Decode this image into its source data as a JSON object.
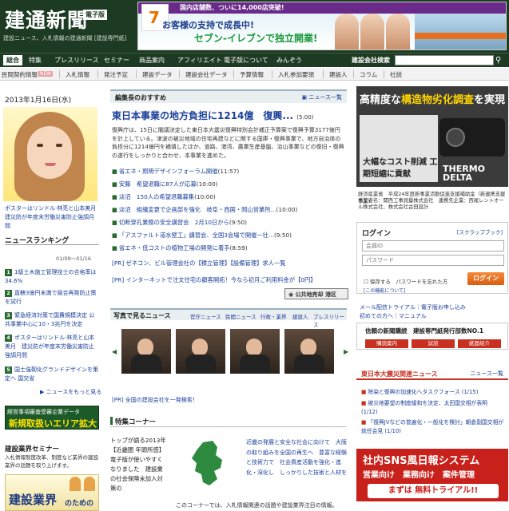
{
  "header": {
    "logo": "建通新聞",
    "edition": "電子版",
    "tagline": "建設ニュース、入札情報の建通新聞 [建設専門紙]",
    "ad": {
      "banner": "国内店舗数、ついに14,000店突破!",
      "line1": "お客様の支持で成長中!",
      "line2": "セブン‐イレブンで独立開業!",
      "mark": "7"
    }
  },
  "nav": {
    "items": [
      "総合",
      "特集",
      "プレスリリース",
      "セミナー",
      "商品案内",
      "アフィリエイト",
      "電子版について",
      "みんぞう"
    ],
    "search_label": "建設会社検索",
    "search_placeholder": "",
    "search_icon": "search-icon"
  },
  "subnav": {
    "items": [
      "民間契約情報",
      "入札情報",
      "発注予定",
      "建設データ",
      "建設会社データ",
      "予算情報",
      "入札参加要領",
      "建設人",
      "コラム",
      "社説"
    ],
    "badge": "NEW"
  },
  "left": {
    "date": "2013年1月16日(水)",
    "poster_caption": "ポスターはリンドル·林亮と山本美月　建災防が年度末労働災害防止強調月間",
    "ranking_title": "ニュースランキング",
    "ranking_date": "01/09～01/16",
    "ranking": [
      {
        "n": "1",
        "text": "1級土木施工管理技士の合格率は34.6%"
      },
      {
        "n": "2",
        "text": "直轄3億円未満で競合再発防止策を試行"
      },
      {
        "n": "3",
        "text": "緊急経済対策で国費規模決定 公共事業中心に10・3兆円を決定"
      },
      {
        "n": "4",
        "text": "ポスターはリンドル·林亮と山本美月　建災防が年度末労働災害防止強調月間"
      },
      {
        "n": "5",
        "text": "国土強靭化グランドデザインを策定へ 国交省"
      }
    ],
    "more_news": "ニュースをもっと見る",
    "banner_top": "経営事項審査受審企業データ",
    "banner_main": "新規取扱いエリア拡大",
    "seminar_title": "建設業界セミナー",
    "seminar_text": "入札情報制度改革、制度など業界の建設業界の話題を取り上げます。",
    "seminar_banner": "建設業界",
    "seminar_banner2": "のための"
  },
  "center": {
    "featured_head": "編集長のおすすめ",
    "featured_more": "ニュース一覧",
    "featured_title": "東日本事業の地方負担に1214億　復興...",
    "featured_time": "(5:00)",
    "featured_body": "復興庁は、15日に閣議決定した東日本大震災復興特別会計補正予算案で復興予算3177億円を計上している。津波の被災地域の住宅再建などに関する国庫・復興事業で、地方自治体の負担分に1214億円を補填したほか、道路、港湾、農業生産基盤、治山事業などの復旧・復興の遂行をしっかりと合わせ、本事業を進めた。",
    "links": [
      {
        "mark": "■",
        "title": "省エネ・照明デザインフォーラム開催",
        "time": "(11:57)"
      },
      {
        "mark": "■",
        "title": "安藤　希望退職に87人が応募",
        "time": "(10:00)"
      },
      {
        "mark": "■",
        "title": "淡沼　150人の希望退職募集",
        "time": "(10:00)"
      },
      {
        "mark": "■",
        "title": "淡沼　組織変更で企画部を強化　岐阜・西国・岡山営業所...",
        "time": "(10:00)"
      },
      {
        "mark": "■",
        "title": "切断穿孔業務の安全講習会　2月10日から",
        "time": "(9:50)"
      },
      {
        "mark": "■",
        "title": "「アスファルト道水壁工」講習会、全国3会場で開催一壮...",
        "time": "(9:50)"
      },
      {
        "mark": "■",
        "title": "省エネ・低コストの植物工場の開発に着手",
        "time": "(8:59)"
      }
    ],
    "pr1": "[PR] ゼネコン、ビル管理会社の【積立管理】【設備管理】求人一覧",
    "pr2": "[PR] インターネットで注文住宅の顧客開拓！今なら初月ご利用料金が【0円】",
    "map_button": "公共地売却 港区",
    "photo_head": "写真で見るニュース",
    "photo_tabs": [
      "官庁ニュース",
      "民間ニュース",
      "行政・業界",
      "建設人",
      "プレスリリース"
    ],
    "pr3": "[PR] 全国の建設会社を一発検索！",
    "special_head": "特集コーナー",
    "special_left": "トップが語る2013年【近畿圏 年頭所感】　電子版が使いやすくなりました　建設業の社会保険未加入対策の",
    "special_right": "近畿の発展と安全な社会に向けて　大阪の取り組みを全国の再生へ　豊富な経験と技術力で　社会資産活動を強化・進化・深化し　しっかりした技術と人材を",
    "special_foot": "このコーナーでは、入札情報関連の話題や建設業界注目の情報。"
  },
  "right": {
    "ad": {
      "headline_a": "高精度な",
      "headline_b": "構造物劣化調査",
      "headline_c": "を実現",
      "sub": "大幅なコスト削減 工期短縮に貢献",
      "brand": "THERMO DELTA",
      "caption1": "経済産業省　平成24年度新事業活動促進支援補助金（新連携支援事業）",
      "caption2": "事業者名：関西工事測量株式会社　連携先企業：西尾レントオール株式会社、株式会社古田設計"
    },
    "login": {
      "title": "ログイン",
      "scrap": "[スクラップブック]",
      "id_placeholder": "会員ID",
      "pw_placeholder": "パスワード",
      "remember": "保存する　パスワードを忘れた方",
      "button": "ログイン",
      "forgot": "[この機能について]"
    },
    "links": [
      "メール配信トライアル｜電子版お申し込み",
      "初めての方へ｜マニュアル"
    ],
    "subscribe": {
      "title": "信頼の新聞購読　建設専門紙発行部数NO.1",
      "buttons": [
        "購読案内",
        "試読",
        "紙面紹介"
      ]
    },
    "quake_head": "東日本大震災関連ニュース",
    "quake_more": "ニュース一覧",
    "quake": [
      {
        "mark": "■",
        "text": "除染と復興の加速化へタスクフォース (1/15)"
      },
      {
        "mark": "■",
        "text": "被災地要望の制度緩和を決定、太田国交相が表明 (1/12)"
      },
      {
        "mark": "■",
        "text": "「復興JVなどの普遍化・一般化を検討」朝倉副国交相が就任会見 (1/10)"
      }
    ],
    "ad2": {
      "title": "社内SNS風日報システム",
      "line": "営業向け　業務向け　案件管理",
      "cta": "まずは 無料トライアル!!"
    }
  },
  "colors": {
    "brand": "#1d3a22",
    "link": "#1a3f9a",
    "accent": "#c8301f"
  }
}
